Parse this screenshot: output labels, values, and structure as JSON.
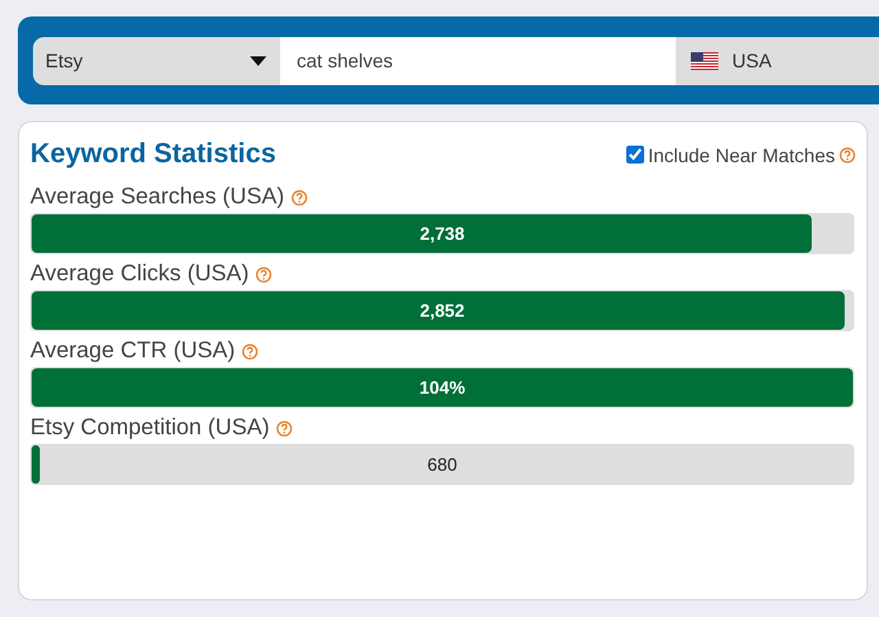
{
  "search_bar": {
    "marketplace": "Etsy",
    "keyword": "cat shelves",
    "country": "USA"
  },
  "keyword_statistics": {
    "title": "Keyword Statistics",
    "near_matches": {
      "label": "Include Near Matches",
      "checked": true
    },
    "metrics": [
      {
        "label": "Average Searches (USA)",
        "value": "2,738",
        "level": 0.95
      },
      {
        "label": "Average Clicks (USA)",
        "value": "2,852",
        "level": 0.99
      },
      {
        "label": "Average CTR (USA)",
        "value": "104%",
        "level": 1
      },
      {
        "label": "Etsy Competition (USA)",
        "value": "680",
        "level": 0.01
      }
    ]
  }
}
